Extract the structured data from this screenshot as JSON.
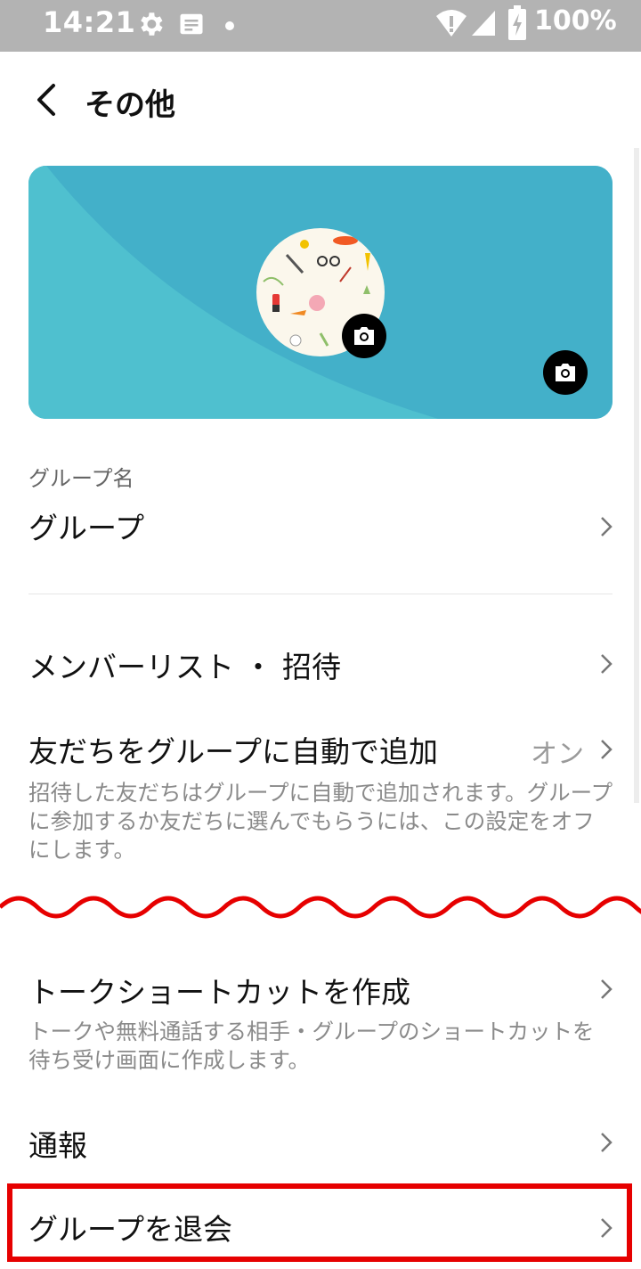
{
  "status_bar": {
    "time": "14:21",
    "battery": "100%",
    "icons": [
      "gear-icon",
      "notification-icon",
      "dot-icon",
      "wifi-icon",
      "signal-icon",
      "battery-icon"
    ]
  },
  "app_bar": {
    "title": "その他",
    "back_icon": "chevron-left-icon"
  },
  "cover": {
    "colors": {
      "primary": "#43b0c9",
      "secondary": "#4fc0cf"
    },
    "camera_icon": "camera-icon"
  },
  "group_name": {
    "label": "グループ名",
    "value": "グループ"
  },
  "rows": {
    "members": {
      "title": "メンバーリスト ・ 招待"
    },
    "auto_add": {
      "title": "友だちをグループに自動で追加",
      "value": "オン",
      "desc": "招待した友だちはグループに自動で追加されます。グループに参加するか友だちに選んでもらうには、この設定をオフにします。"
    },
    "shortcut": {
      "title": "トークショートカットを作成",
      "desc": "トークや無料通話する相手・グループのショートカットを待ち受け画面に作成します。"
    },
    "report": {
      "title": "通報"
    },
    "leave": {
      "title": "グループを退会"
    }
  },
  "annotation": {
    "highlight_color": "#e60000",
    "wave_color": "#e60000"
  }
}
